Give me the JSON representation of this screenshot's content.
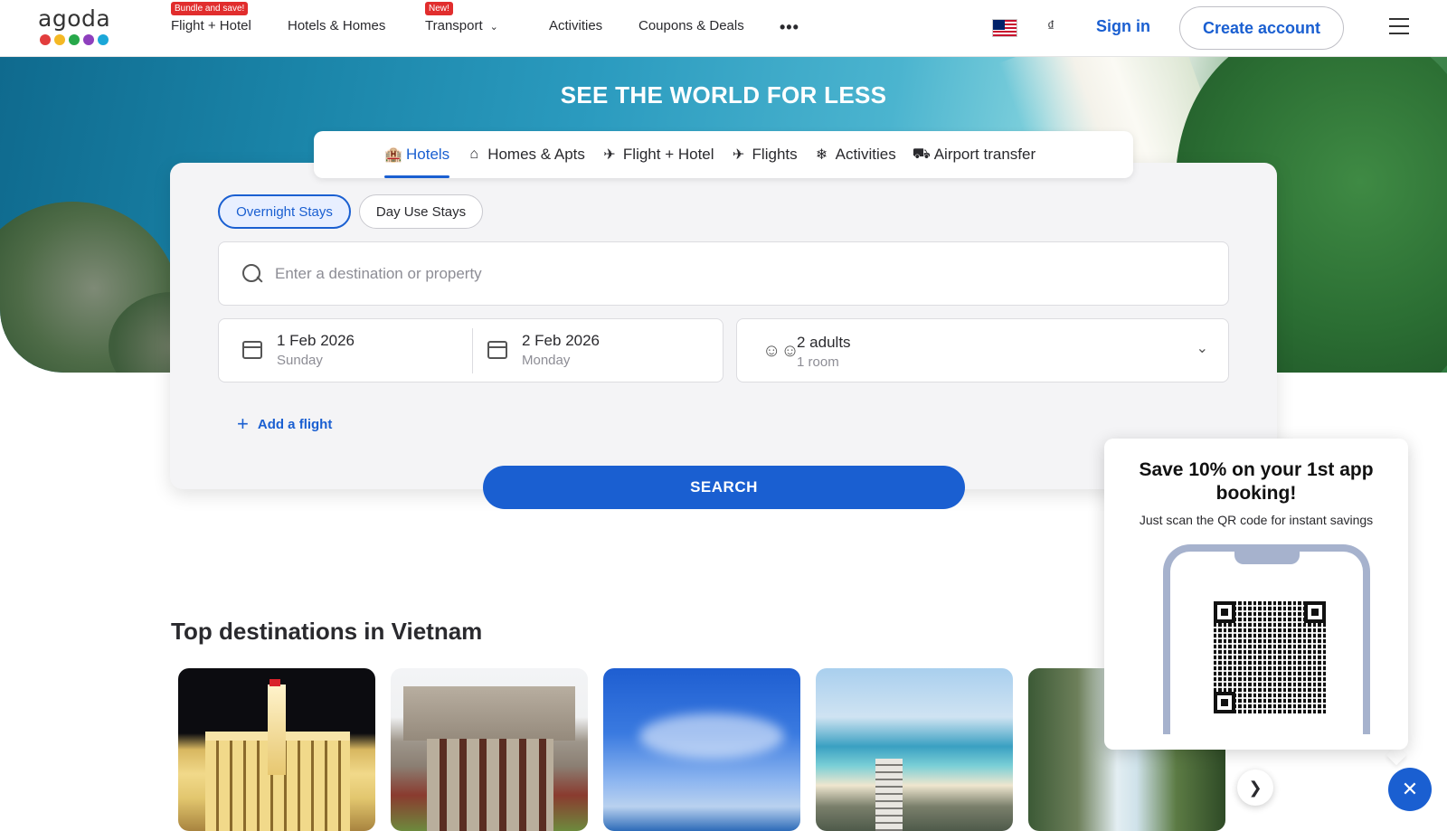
{
  "header": {
    "logo_text": "agoda",
    "logo_colors": [
      "#e23d3d",
      "#f4b824",
      "#27a84a",
      "#8e3fbd",
      "#1ba7d8"
    ],
    "nav": [
      {
        "label": "Flight + Hotel",
        "badge": "Bundle and save!"
      },
      {
        "label": "Hotels & Homes",
        "badge": ""
      },
      {
        "label": "Transport",
        "badge": "New!"
      },
      {
        "label": "Activities",
        "badge": ""
      },
      {
        "label": "Coupons & Deals",
        "badge": ""
      }
    ],
    "more": "•••",
    "currency": "₫",
    "sign_in": "Sign in",
    "create_account": "Create account",
    "brand_color": "#1a5fd1"
  },
  "hero": {
    "title": "SEE THE WORLD FOR LESS"
  },
  "tabs": [
    {
      "label": "Hotels",
      "icon": "hotel-icon",
      "active": true
    },
    {
      "label": "Homes & Apts",
      "icon": "home-icon",
      "active": false
    },
    {
      "label": "Flight + Hotel",
      "icon": "flight-hotel-icon",
      "active": false
    },
    {
      "label": "Flights",
      "icon": "plane-icon",
      "active": false
    },
    {
      "label": "Activities",
      "icon": "activities-icon",
      "active": false
    },
    {
      "label": "Airport transfer",
      "icon": "car-icon",
      "active": false
    }
  ],
  "search": {
    "stay_types": {
      "overnight": "Overnight Stays",
      "day_use": "Day Use Stays",
      "selected": "Overnight Stays"
    },
    "destination_placeholder": "Enter a destination or property",
    "destination_value": "",
    "checkin": {
      "date": "1 Feb 2026",
      "day": "Sunday"
    },
    "checkout": {
      "date": "2 Feb 2026",
      "day": "Monday"
    },
    "guests": {
      "main": "2 adults",
      "sub": "1 room"
    },
    "add_flight": "Add a flight",
    "search_button": "SEARCH"
  },
  "destinations": {
    "title": "Top destinations in Vietnam",
    "card_count_visible": 5
  },
  "promo": {
    "title": "Save 10% on your 1st app booking!",
    "subtitle": "Just scan the QR code for instant savings"
  }
}
